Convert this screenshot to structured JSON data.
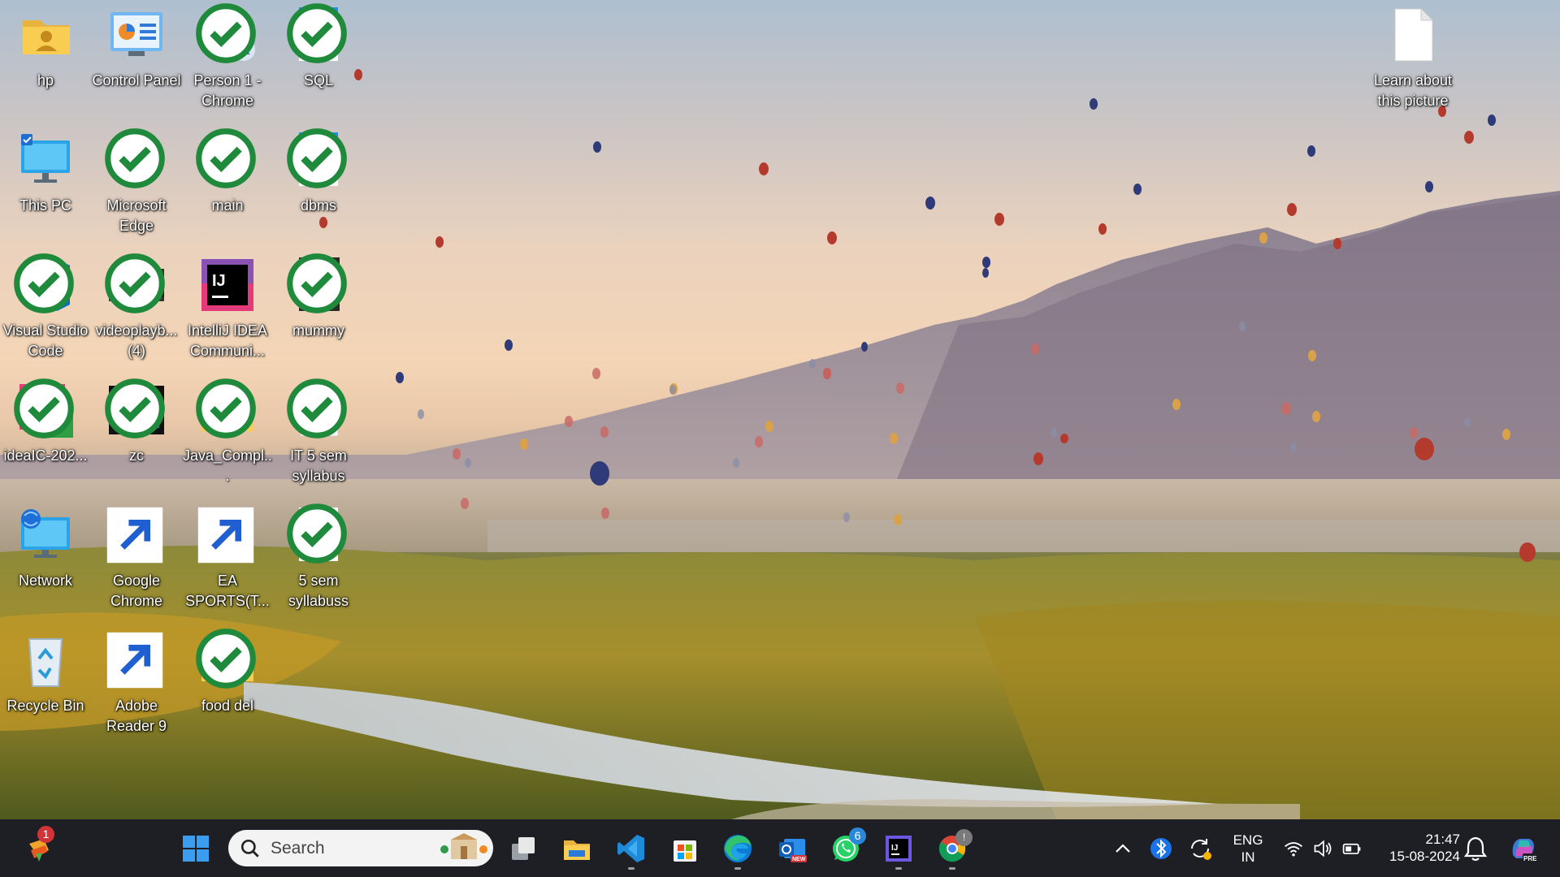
{
  "desktop": {
    "icons": [
      {
        "label": "hp",
        "icon": "user-folder-icon"
      },
      {
        "label": "Control Panel",
        "icon": "control-panel-icon"
      },
      {
        "label": "Person 1 - Chrome",
        "icon": "chrome-profile-icon"
      },
      {
        "label": "SQL",
        "icon": "edge-document-icon"
      },
      {
        "label": "This PC",
        "icon": "monitor-icon"
      },
      {
        "label": "Microsoft Edge",
        "icon": "edge-icon"
      },
      {
        "label": "main",
        "icon": "edge-icon"
      },
      {
        "label": "dbms",
        "icon": "edge-document-icon"
      },
      {
        "label": "Visual Studio Code",
        "icon": "vscode-icon"
      },
      {
        "label": "videoplayb... (4)",
        "icon": "video-thumbnail-icon"
      },
      {
        "label": "IntelliJ IDEA Communi...",
        "icon": "intellij-icon"
      },
      {
        "label": "mummy",
        "icon": "photo-thumbnail-icon"
      },
      {
        "label": "ideaIC-202...",
        "icon": "intellij-installer-icon"
      },
      {
        "label": "zc",
        "icon": "keyboard-image-icon"
      },
      {
        "label": "Java_Compl...",
        "icon": "excel-folder-icon"
      },
      {
        "label": "IT 5 sem syllabus",
        "icon": "blank-document-icon"
      },
      {
        "label": "Network",
        "icon": "network-icon"
      },
      {
        "label": "Google Chrome",
        "icon": "chrome-icon"
      },
      {
        "label": "EA SPORTS(T...",
        "icon": "cricket-ball-icon"
      },
      {
        "label": "5 sem syllabuss",
        "icon": "edge-document-icon"
      },
      {
        "label": "Recycle Bin",
        "icon": "recycle-bin-icon"
      },
      {
        "label": "Adobe Reader 9",
        "icon": "adobe-reader-icon"
      },
      {
        "label": "food del",
        "icon": "folder-icon"
      }
    ],
    "learn_about": {
      "label": "Learn about this picture",
      "icon": "blank-document-icon"
    }
  },
  "taskbar": {
    "widgets_badge": "1",
    "search_placeholder": "Search",
    "whatsapp_badge": "6",
    "chrome_badge": "!",
    "language": {
      "line1": "ENG",
      "line2": "IN"
    },
    "time": "21:47",
    "date": "15-08-2024",
    "copilot_tag": "PRE"
  }
}
